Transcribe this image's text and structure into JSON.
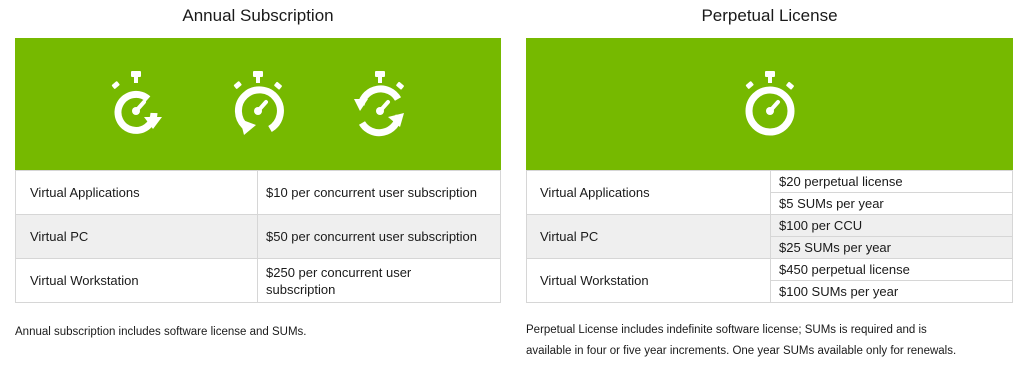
{
  "annual": {
    "title": "Annual Subscription",
    "icons": [
      "stopwatch-arrow-right-icon",
      "stopwatch-arrow-left-icon",
      "stopwatch-refresh-icon"
    ],
    "rows": [
      {
        "product": "Virtual Applications",
        "price": "$10 per concurrent user subscription"
      },
      {
        "product": "Virtual PC",
        "price": "$50 per concurrent user subscription"
      },
      {
        "product": "Virtual Workstation",
        "price": "$250 per concurrent user subscription"
      }
    ],
    "note": "Annual subscription includes software license and SUMs."
  },
  "perpetual": {
    "title": "Perpetual License",
    "icons": [
      "stopwatch-icon"
    ],
    "rows": [
      {
        "product": "Virtual Applications",
        "license": "$20 perpetual license",
        "sums": "$5 SUMs per year"
      },
      {
        "product": "Virtual PC",
        "license": "$100 per CCU",
        "sums": "$25 SUMs per year"
      },
      {
        "product": "Virtual Workstation",
        "license": "$450 perpetual license",
        "sums": "$100 SUMs per year"
      }
    ],
    "note_line1": "Perpetual License includes indefinite software license; SUMs is required and is",
    "note_line2": "available in four or five year increments. One year SUMs available only for renewals."
  },
  "colors": {
    "banner": "#76b900",
    "shade": "#efefef",
    "border": "#d6d6d6"
  }
}
